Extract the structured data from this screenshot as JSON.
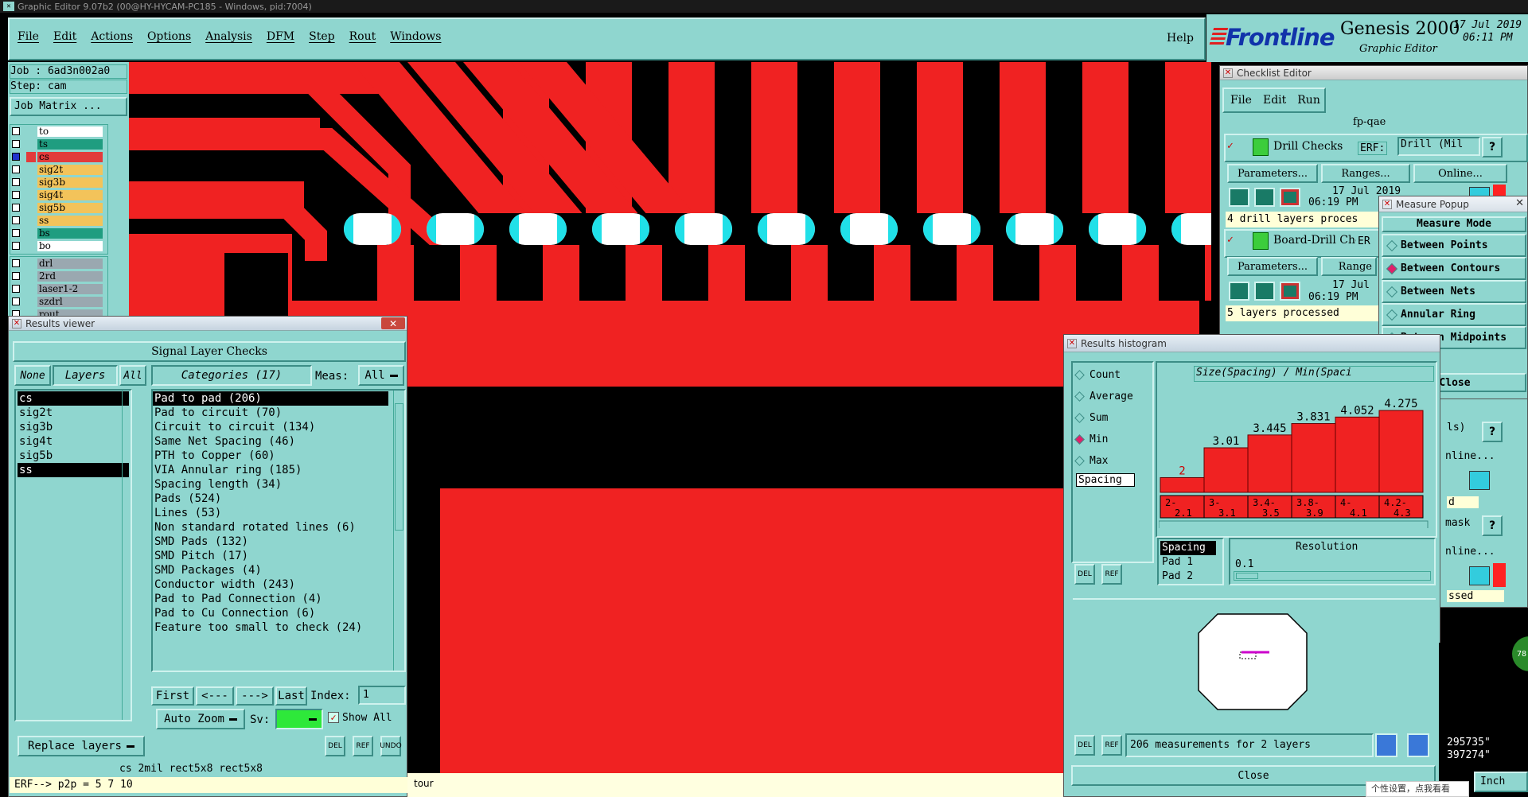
{
  "app": {
    "title": "Graphic Editor 9.07b2 (00@HY-HYCAM-PC185 - Windows, pid:7004)",
    "menu": [
      "File",
      "Edit",
      "Actions",
      "Options",
      "Analysis",
      "DFM",
      "Step",
      "Rout",
      "Windows"
    ],
    "help": "Help",
    "brand": "Frontline",
    "product": "Genesis 2000",
    "subtitle": "Graphic Editor",
    "date": "17 Jul 2019",
    "time": "06:11 PM"
  },
  "left_panel": {
    "job": "Job : 6ad3n002a0",
    "step": "Step: cam",
    "job_matrix": "Job Matrix ...",
    "layers": [
      {
        "name": "to",
        "color": "#ffffff",
        "selected": false
      },
      {
        "name": "ts",
        "color": "#1f9d80",
        "selected": false
      },
      {
        "name": "cs",
        "color": "#e23b3b",
        "selected": true
      },
      {
        "name": "sig2t",
        "color": "#f3c35a",
        "selected": false
      },
      {
        "name": "sig3b",
        "color": "#f3c35a",
        "selected": false
      },
      {
        "name": "sig4t",
        "color": "#f3c35a",
        "selected": false
      },
      {
        "name": "sig5b",
        "color": "#f3c35a",
        "selected": false
      },
      {
        "name": "ss",
        "color": "#f3c35a",
        "selected": false
      },
      {
        "name": "bs",
        "color": "#1f9d80",
        "selected": false
      },
      {
        "name": "bo",
        "color": "#ffffff",
        "selected": false
      }
    ],
    "layers2": [
      {
        "name": "drl",
        "color": "#9aa8b0"
      },
      {
        "name": "2rd",
        "color": "#9aa8b0"
      },
      {
        "name": "laser1-2",
        "color": "#9aa8b0"
      },
      {
        "name": "szdrl",
        "color": "#9aa8b0"
      },
      {
        "name": "rout",
        "color": "#9aa8b0"
      }
    ]
  },
  "results_viewer": {
    "title": "Results viewer",
    "header": "Signal Layer Checks",
    "none": "None",
    "layers": "Layers",
    "all": "All",
    "categories": "Categories (17)",
    "meas": "Meas:",
    "meas_value": "All",
    "layer_list": [
      {
        "name": "cs",
        "selected": true
      },
      {
        "name": "sig2t",
        "selected": false
      },
      {
        "name": "sig3b",
        "selected": false
      },
      {
        "name": "sig4t",
        "selected": false
      },
      {
        "name": "sig5b",
        "selected": false
      },
      {
        "name": "ss",
        "selected": true
      }
    ],
    "category_list": [
      {
        "name": "Pad to pad (206)",
        "selected": true
      },
      {
        "name": "Pad to circuit (70)",
        "selected": false
      },
      {
        "name": "Circuit to circuit (134)",
        "selected": false
      },
      {
        "name": "Same Net Spacing (46)",
        "selected": false
      },
      {
        "name": "PTH to Copper (60)",
        "selected": false
      },
      {
        "name": "VIA Annular ring (185)",
        "selected": false
      },
      {
        "name": "Spacing length (34)",
        "selected": false
      },
      {
        "name": "Pads (524)",
        "selected": false
      },
      {
        "name": "Lines (53)",
        "selected": false
      },
      {
        "name": "Non standard rotated lines (6)",
        "selected": false
      },
      {
        "name": "SMD Pads (132)",
        "selected": false
      },
      {
        "name": "SMD Pitch (17)",
        "selected": false
      },
      {
        "name": "SMD Packages (4)",
        "selected": false
      },
      {
        "name": "Conductor width (243)",
        "selected": false
      },
      {
        "name": "Pad to Pad Connection (4)",
        "selected": false
      },
      {
        "name": "Pad to Cu Connection (6)",
        "selected": false
      },
      {
        "name": "Feature too small to check (24)",
        "selected": false
      }
    ],
    "first": "First",
    "prev": "<---",
    "next": "--->",
    "last": "Last",
    "index_label": "Index:",
    "index_value": "1",
    "auto_zoom": "Auto Zoom",
    "sv": "Sv:",
    "show_all": "Show All",
    "replace_layers": "Replace layers",
    "del": "DEL",
    "ref": "REF",
    "undo": "UNDO",
    "status": "cs 2mil   rect5x8   rect5x8",
    "erf": "ERF--> p2p = 5 7 10"
  },
  "bottom_status": {
    "tour": "tour"
  },
  "checklist": {
    "title": "Checklist Editor",
    "menu": [
      "File",
      "Edit",
      "Run"
    ],
    "name": "fp-qae",
    "rows": [
      {
        "name": "Drill Checks",
        "erf": "ERF:",
        "erf_value": "Drill (Mil",
        "params": "Parameters...",
        "ranges": "Ranges...",
        "online": "Online...",
        "date": "17 Jul 2019",
        "time": "06:19 PM",
        "status": "4 drill layers proces"
      },
      {
        "name": "Board-Drill Che",
        "erf": "ER",
        "params": "Parameters...",
        "ranges": "Range",
        "date": "17 Jul",
        "time": "06:19 PM",
        "status": "5 layers processed"
      }
    ],
    "right_fragments": [
      "ls)",
      "nline...",
      "d",
      "mask",
      "nline...",
      "ssed"
    ]
  },
  "measure_popup": {
    "title": "Measure Popup",
    "header": "Measure Mode",
    "options": [
      {
        "label": "Between Points",
        "selected": false
      },
      {
        "label": "Between Contours",
        "selected": true
      },
      {
        "label": "Between Nets",
        "selected": false
      },
      {
        "label": "Annular Ring",
        "selected": false
      },
      {
        "label": "Between Midpoints",
        "selected": false
      }
    ],
    "close": "Close"
  },
  "histogram": {
    "title": "Results histogram",
    "radios": [
      {
        "label": "Count",
        "selected": false
      },
      {
        "label": "Average",
        "selected": false
      },
      {
        "label": "Sum",
        "selected": false
      },
      {
        "label": "Min",
        "selected": true
      },
      {
        "label": "Max",
        "selected": false
      }
    ],
    "list_item": "Spacing",
    "chart_title": "Size(Spacing) / Min(Spaci",
    "chart_data": {
      "type": "bar",
      "categories": [
        "2-2.1",
        "3-3.1",
        "3.4-3.5",
        "3.8-3.9",
        "4-4.1",
        "4.2-4.3"
      ],
      "values": [
        2,
        3.01,
        3.445,
        3.831,
        4.052,
        4.275
      ],
      "labels": [
        "2",
        "3.01",
        "3.445",
        "3.831",
        "4.052",
        "4.275"
      ]
    },
    "spacing_box": [
      "Spacing",
      "Pad 1",
      "Pad 2"
    ],
    "resolution_label": "Resolution",
    "resolution_value": "0.1",
    "summary": "206 measurements for 2 layers",
    "close": "Close",
    "del": "DEL",
    "ref": "REF"
  },
  "right_edge": {
    "coord1": "295735\"",
    "coord2": "397274\"",
    "unit": "Inch",
    "badge": "78"
  },
  "notice": "个性设置，点我看看"
}
